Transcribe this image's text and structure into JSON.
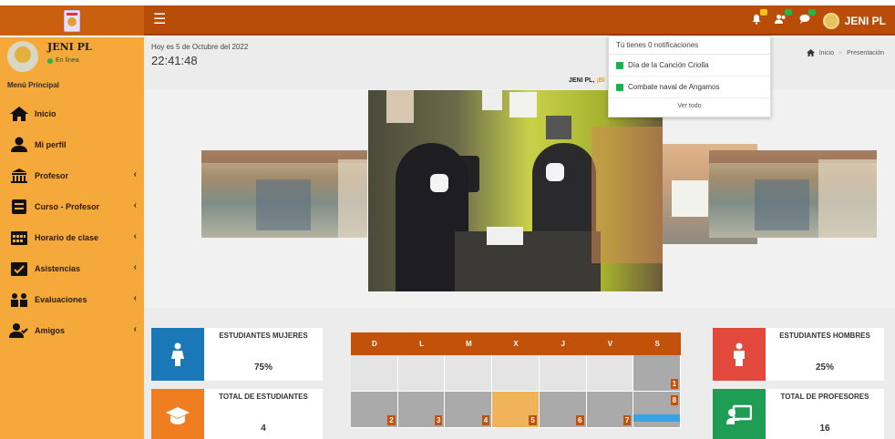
{
  "topbar": {
    "menu_icon": "bars-icon",
    "user_name": "JENI PL",
    "icons": [
      "bell-icon",
      "users-icon",
      "chat-icon"
    ],
    "badge_colors": [
      "#f4c21a",
      "#2ab34a",
      "#2ab34a"
    ]
  },
  "sidebar": {
    "user_name": "JENI PL",
    "status": "En línea",
    "menu_title": "Menú Principal",
    "items": [
      {
        "label": "Inicio",
        "icon": "home-icon",
        "has_submenu": false
      },
      {
        "label": "Mi perfil",
        "icon": "user-icon",
        "has_submenu": false
      },
      {
        "label": "Profesor",
        "icon": "building-icon",
        "has_submenu": true
      },
      {
        "label": "Curso - Profesor",
        "icon": "book-icon",
        "has_submenu": true
      },
      {
        "label": "Horario de clase",
        "icon": "calendar-icon",
        "has_submenu": true
      },
      {
        "label": "Asistencias",
        "icon": "calendar-check-icon",
        "has_submenu": true
      },
      {
        "label": "Evaluaciones",
        "icon": "users-icon",
        "has_submenu": true
      },
      {
        "label": "Amigos",
        "icon": "user-check-icon",
        "has_submenu": true
      }
    ]
  },
  "header": {
    "date_text": "Hoy es 5 de Octubre del 2022",
    "time": "22:41:48",
    "breadcrumb": {
      "home": "Inicio",
      "current": "Presentación"
    },
    "greeting_name": "JENI PL,",
    "greeting_extra": "¡Bi"
  },
  "notifications": {
    "header": "Tú tienes 0 notificaciones",
    "items": [
      "Día de la Canción Criolla",
      "Combate naval de Angamos"
    ],
    "footer": "Ver todo"
  },
  "stats": {
    "left": [
      {
        "title": "ESTUDIANTES MUJERES",
        "value": "75%",
        "color": "#1b78b8",
        "icon": "female-icon"
      },
      {
        "title": "TOTAL DE ESTUDIANTES",
        "value": "4",
        "color": "#f07d1f",
        "icon": "graduation-cap-icon"
      }
    ],
    "right": [
      {
        "title": "ESTUDIANTES HOMBRES",
        "value": "25%",
        "color": "#e2493c",
        "icon": "male-icon"
      },
      {
        "title": "TOTAL DE PROFESORES",
        "value": "16",
        "color": "#1f9d55",
        "icon": "chalkboard-teacher-icon"
      }
    ]
  },
  "calendar": {
    "days": [
      "D",
      "L",
      "M",
      "X",
      "J",
      "V",
      "S"
    ],
    "rows": [
      [
        "",
        "",
        "",
        "",
        "",
        "",
        "1"
      ],
      [
        "2",
        "3",
        "4",
        "5",
        "6",
        "7",
        "8"
      ]
    ],
    "today": "5"
  }
}
